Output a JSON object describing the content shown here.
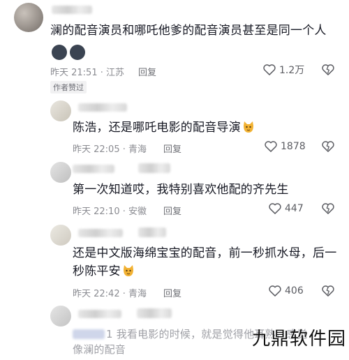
{
  "comments": [
    {
      "text": "澜的配音演员和哪吒他爹的配音演员甚至是同一个人",
      "time": "昨天 21:51 · 江苏",
      "reply": "回复",
      "likes": "1.2万",
      "author_badge": "作者赞过"
    },
    {
      "text": "陈浩，还是哪吒电影的配音导演",
      "time": "昨天 22:05 · 青海",
      "reply": "回复",
      "likes": "1878"
    },
    {
      "text": "第一次知道哎，我特别喜欢他配的齐先生",
      "time": "昨天 22:10 · 安徽",
      "reply": "回复",
      "likes": "447"
    },
    {
      "text_line1": "还是中文版海绵宝宝的配音，前一秒抓水母，后一",
      "text_line2": "秒陈平安",
      "time": "昨天 22:42 · 青海",
      "reply": "回复",
      "likes": "406"
    },
    {
      "text_line1": "1 我看电影的时候，就是觉得他耳熟，感觉",
      "text_line2": "像澜的配音"
    }
  ],
  "watermark": "九鼎软件园",
  "colors": {
    "text": "#161823",
    "meta": "#8a8b91",
    "sticker": "#f2b233"
  },
  "icons": [
    "heart-outline-icon",
    "dislike-heart-icon",
    "cat-sticker-icon",
    "round-emoji-icon"
  ]
}
